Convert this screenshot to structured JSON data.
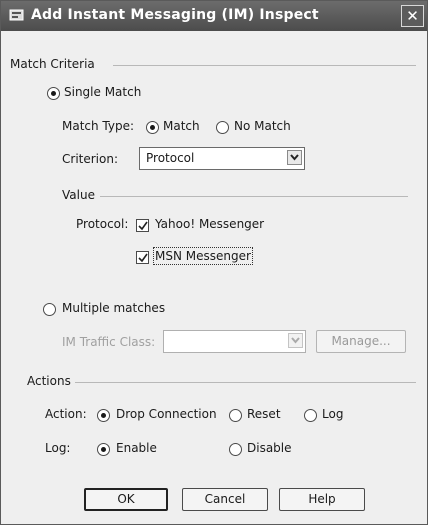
{
  "window": {
    "title": "Add Instant Messaging (IM) Inspect",
    "close_glyph": "✕"
  },
  "match_criteria": {
    "legend": "Match Criteria",
    "single_match_label": "Single Match",
    "single_match_selected": true,
    "match_type": {
      "label": "Match Type:",
      "options": [
        {
          "label": "Match",
          "selected": true
        },
        {
          "label": "No Match",
          "selected": false
        }
      ]
    },
    "criterion": {
      "label": "Criterion:",
      "value": "Protocol"
    },
    "value": {
      "legend": "Value",
      "protocol_label": "Protocol:",
      "protocols": [
        {
          "label": "Yahoo! Messenger",
          "checked": true
        },
        {
          "label": "MSN Messenger",
          "checked": true
        }
      ]
    },
    "multiple_matches_label": "Multiple matches",
    "multiple_matches_selected": false,
    "im_traffic_class": {
      "label": "IM Traffic Class:",
      "value": ""
    },
    "manage_label": "Manage..."
  },
  "actions": {
    "legend": "Actions",
    "action": {
      "label": "Action:",
      "options": [
        {
          "label": "Drop Connection",
          "selected": true
        },
        {
          "label": "Reset",
          "selected": false
        },
        {
          "label": "Log",
          "selected": false
        }
      ]
    },
    "log": {
      "label": "Log:",
      "options": [
        {
          "label": "Enable",
          "selected": true
        },
        {
          "label": "Disable",
          "selected": false
        }
      ]
    }
  },
  "buttons": {
    "ok": "OK",
    "cancel": "Cancel",
    "help": "Help"
  },
  "icons": {
    "app": "dialog-app-icon",
    "close": "close-icon",
    "dropdown": "chevron-down-icon",
    "check": "check-icon"
  }
}
